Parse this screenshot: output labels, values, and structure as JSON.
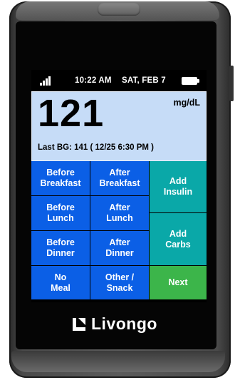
{
  "brand": {
    "name": "Livongo"
  },
  "status_bar": {
    "time": "10:22 AM",
    "date": "SAT, FEB 7"
  },
  "reading": {
    "value": "121",
    "unit": "mg/dL",
    "last_bg": "Last BG: 141 ( 12/25 6:30 PM )"
  },
  "buttons": {
    "before_breakfast": [
      "Before",
      "Breakfast"
    ],
    "after_breakfast": [
      "After",
      "Breakfast"
    ],
    "before_lunch": [
      "Before",
      "Lunch"
    ],
    "after_lunch": [
      "After",
      "Lunch"
    ],
    "before_dinner": [
      "Before",
      "Dinner"
    ],
    "after_dinner": [
      "After",
      "Dinner"
    ],
    "no_meal": [
      "No",
      "Meal"
    ],
    "other_snack": [
      "Other /",
      "Snack"
    ],
    "add_insulin": [
      "Add",
      "Insulin"
    ],
    "add_carbs": [
      "Add",
      "Carbs"
    ],
    "next": "Next"
  },
  "colors": {
    "meal_button": "#0b5fe6",
    "action_button": "#0aa8a8",
    "next_button": "#3cb54a",
    "reading_panel": "#c6dcf7"
  },
  "icons": {
    "signal": "signal-strength-icon",
    "battery": "battery-icon",
    "logo": "livongo-logo-icon"
  }
}
